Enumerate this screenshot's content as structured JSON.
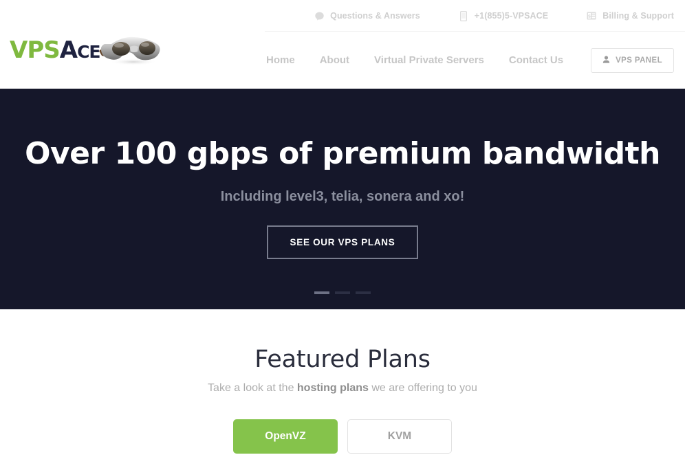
{
  "topbar": {
    "items": [
      {
        "icon": "speech-bubble-icon",
        "label": "Questions & Answers"
      },
      {
        "icon": "mobile-phone-icon",
        "label": "+1(855)5-VPSACE"
      },
      {
        "icon": "money-bill-icon",
        "label": "Billing & Support"
      }
    ]
  },
  "logo": {
    "part1": "VPS",
    "part2_a": "A",
    "part2_ce": "CE",
    "graphic": "goggles-icon"
  },
  "nav": {
    "items": [
      {
        "label": "Home"
      },
      {
        "label": "About"
      },
      {
        "label": "Virtual Private Servers"
      },
      {
        "label": "Contact Us"
      }
    ],
    "panel_button": {
      "icon": "user-icon",
      "label": "VPS PANEL"
    }
  },
  "hero": {
    "title": "Over 100 gbps of premium bandwidth",
    "subtitle": "Including level3, telia, sonera and xo!",
    "cta_label": "SEE OUR VPS PLANS",
    "background_color": "#15172a",
    "slides": 3,
    "active_slide": 1
  },
  "plans": {
    "heading": "Featured Plans",
    "subtitle_pre": "Take a look at the ",
    "subtitle_bold": "hosting plans",
    "subtitle_post": " we are offering to you",
    "tabs": [
      {
        "label": "OpenVZ",
        "active": true
      },
      {
        "label": "KVM",
        "active": false
      }
    ]
  },
  "colors": {
    "brand_green": "#85c34b",
    "logo_green": "#7fb93f",
    "dark_navy": "#15172a",
    "logo_navy": "#1f2340",
    "muted_text": "#c6c6c6"
  }
}
